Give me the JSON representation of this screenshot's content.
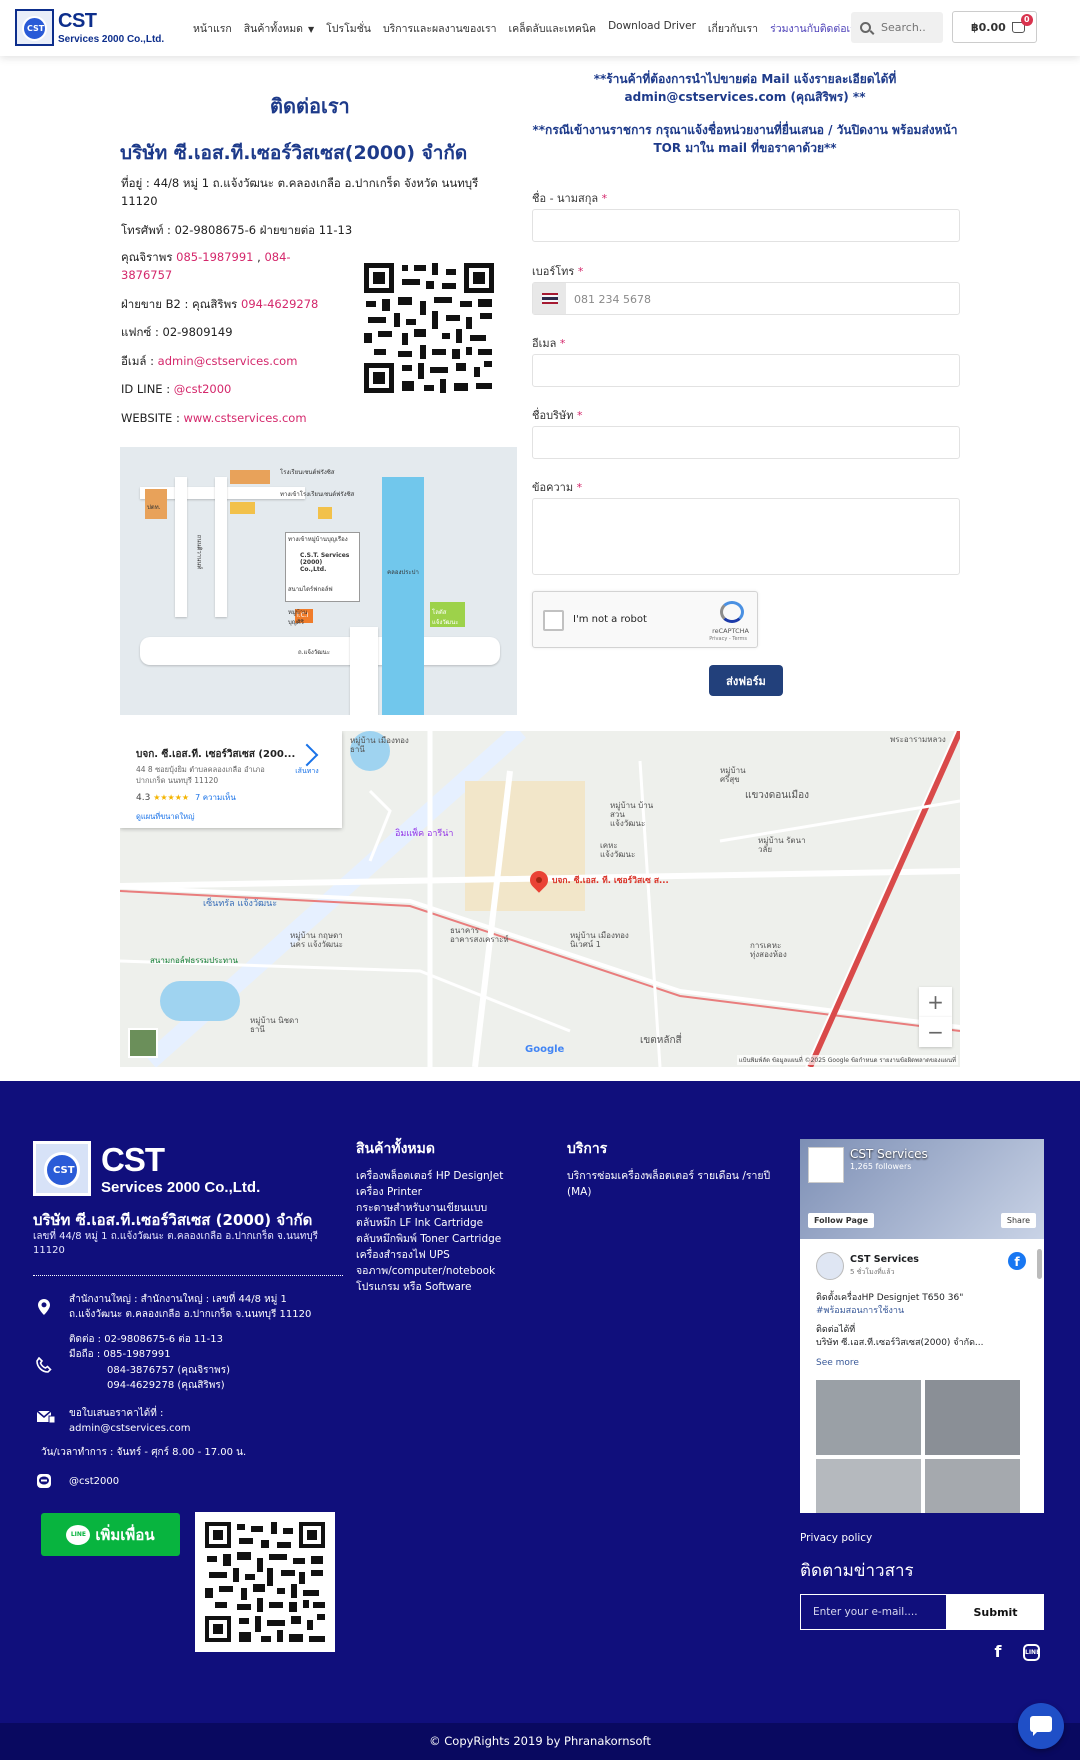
{
  "header": {
    "logo": {
      "big": "CST",
      "small": "Services 2000 Co.,Ltd.",
      "mark": "CST"
    },
    "nav": [
      {
        "label": "หน้าแรก"
      },
      {
        "label": "สินค้าทั้งหมด"
      },
      {
        "label": "โปรโมชั่น"
      },
      {
        "label": "บริการและผลงานของเรา"
      },
      {
        "label": "เคล็ดลับและเทคนิค"
      },
      {
        "label": "Download Driver"
      },
      {
        "label": "เกี่ยวกับเรา"
      },
      {
        "label": "ร่วมงานกับติดต่อเรา"
      }
    ],
    "search_placeholder": "Search..",
    "cart_total": "฿0.00",
    "cart_count": "0"
  },
  "contact": {
    "title": "ติดต่อเรา",
    "company": "บริษัท ซี.เอส.ที.เซอร์วิสเซส(2000) จำกัด",
    "address": "ที่อยู่ : 44/8 หมู่ 1 ถ.แจ้งวัฒนะ ต.คลองเกลือ อ.ปากเกร็ด จังหวัด นนทบุรี 11120",
    "phone": "โทรศัพท์  : 02-9808675-6 ฝ่ายขายต่อ 11-13",
    "mobile_label": "คุณจิราพร ",
    "mobile_1": "085-1987991",
    "mobile_sep": " , ",
    "mobile_2": "084-3876757",
    "sales_label": "ฝ่ายขาย B2 : คุณสิริพร ",
    "sales_phone": "094-4629278",
    "fax": "แฟกซ์ : 02-9809149",
    "email_label": "อีเมล์ : ",
    "email": "admin@cstservices.com",
    "line_label": "ID LINE : ",
    "line_id": "@cst2000",
    "website_label": "WEBSITE : ",
    "website": "www.cstservices.com"
  },
  "route_map": {
    "labels": [
      "โรงเรียนเซนต์ฟรังซิส",
      "ทางเข้าโรงเรียนเซนต์ฟรังซิส",
      "ปตท.",
      "ทางเข้าหมู่บ้านบุญเรือง",
      "C.S.T. Services (2000) Co.,Ltd.",
      "คลองประปา",
      "ถนนติวานนท์",
      "สนามไดร์ฟกอล์ฟ",
      "หมู่บ้านบุญศิริ",
      "I.C.I",
      "โลตัส แจ้งวัฒนะ",
      "ถ.แจ้งวัฒนะ"
    ]
  },
  "form": {
    "notice_1": "**ร้านค้าที่ต้องการนำไปขายต่อ Mail แจ้งรายละเอียดได้ที่ admin@cstservices.com (คุณสิริพร) **",
    "notice_2": "**กรณีเข้างานราชการ กรุณาแจ้งชื่อหน่วยงานที่ยื่นเสนอ / วันปิดงาน พร้อมส่งหน้า TOR มาใน mail ที่ขอราคาด้วย**",
    "fields": [
      {
        "label": "ชื่อ - นามสกุล",
        "required": "*"
      },
      {
        "label": "เบอร์โทร",
        "required": "*",
        "placeholder": "081 234 5678"
      },
      {
        "label": "อีเมล",
        "required": "*"
      },
      {
        "label": "ชื่อบริษัท",
        "required": "*"
      },
      {
        "label": "ข้อความ",
        "required": "*"
      }
    ],
    "captcha_label": "I'm not a robot",
    "captcha_brand": "reCAPTCHA",
    "captcha_terms": "Privacy - Terms",
    "submit": "ส่งฟอร์ม"
  },
  "gmap": {
    "place_name": "บจก. ซี.เอส.ที. เซอร์วิสเซส (200...",
    "place_address": "44 8 ซอยบุ้งยิม ตำบลคลองเกลือ อำเภอ ปากเกร็ด นนทบุรี 11120",
    "rating": "4.3",
    "stars": "★★★★★",
    "reviews": "7 ความเห็น",
    "larger_map": "ดูแผนที่ขนาดใหญ่",
    "directions": "เส้นทาง",
    "pin_label": "บจก. ซี.เอส. ที. เซอร์วิสเซ ส...",
    "labels": [
      "หมู่บ้าน เมืองทองธานี",
      "หมู่บ้าน ศรีสุข",
      "แขวงดอนเมือง",
      "หมู่บ้าน บ้านสวน แจ้งวัฒนะ",
      "เคหะ แจ้งวัฒนะ",
      "หมู่บ้าน รัตนาวลัย",
      "เซ็นทรัล แจ้งวัฒนะ",
      "หมู่บ้าน เมืองทอง นิเวศน์ 1",
      "การเคหะ ทุ่งสองห้อง",
      "หมู่บ้าน นิชดาธานี",
      "เขตหลักสี่",
      "สนามกอล์ฟธรรมประทาน",
      "หมู่บ้าน กฤษดานคร แจ้งวัฒนะ",
      "ธนาคารอาคารสงเคราะห์",
      "อิมแพ็ค อารีน่า",
      "พระอารามหลวง"
    ],
    "logo": "Google",
    "attribution": "แป้นพิมพ์ลัด  ข้อมูลแผนที่ ©2025 Google  ข้อกำหนด  รายงานข้อผิดพลาดของแผนที่",
    "zoom_in": "+",
    "zoom_out": "−"
  },
  "footer": {
    "logo": {
      "big": "CST",
      "small": "Services 2000 Co.,Ltd.",
      "mark": "CST"
    },
    "company": "บริษัท ซี.เอส.ที.เซอร์วิสเซส (2000) จำกัด",
    "address": "เลขที่ 44/8 หมู่ 1 ถ.แจ้งวัฒนะ ต.คลองเกลือ อ.ปากเกร็ด จ.นนทบุรี 11120",
    "office": "สำนักงานใหญ่ : สำนักงานใหญ่ : เลขที่ 44/8 หมู่ 1 ถ.แจ้งวัฒนะ ต.คลองเกลือ อ.ปากเกร็ด จ.นนทบุรี 11120",
    "contact_1": "ติดต่อ : 02-9808675-6 ต่อ 11-13",
    "contact_2": "มือถือ : 085-1987991",
    "contact_3": "084-3876757 (คุณจิราพร)",
    "contact_4": "094-4629278 (คุณสิริพร)",
    "quote_1": "ขอใบเสนอราคาได้ที่ :",
    "quote_2": "admin@cstservices.com",
    "hours": "วัน/เวลาทำการ : จันทร์ - ศุกร์ 8.00 - 17.00 น.",
    "line_id": "@cst2000",
    "line_button": "เพิ่มเพื่อน",
    "line_icon": "LINE",
    "products_heading": "สินค้าทั้งหมด",
    "products": [
      "เครื่องพล็อตเตอร์ HP DesignJet",
      "เครื่อง Printer",
      "กระดาษสำหรับงานเขียนแบบ",
      "ตลับหมึก LF Ink Cartridge",
      "ตลับหมึกพิมพ์ Toner Cartridge",
      "เครื่องสำรองไฟ UPS",
      "จอภาพ/computer/notebook",
      "โปรแกรม หรือ Software"
    ],
    "services_heading": "บริการ",
    "services": [
      "บริการซ่อมเครื่องพล็อตเตอร์ รายเดือน /รายปี (MA)"
    ],
    "fb": {
      "page_name": "CST Services",
      "followers": "1,265 followers",
      "follow": "Follow Page",
      "share": "Share",
      "post_name": "CST Services",
      "post_time": "5 ชั่วโมงที่แล้ว",
      "post_line1": "ติดตั้งเครื่องHP Designjet T650 36\"",
      "post_tag": "#พร้อมสอนการใช้งาน",
      "post_line2": "ติดต่อได้ที่",
      "post_line3": "บริษัท ซี.เอส.ที.เซอร์วิสเซส(2000) จำกัด...",
      "see_more": "See more"
    },
    "privacy": "Privacy policy",
    "newsletter_heading": "ติดตามข่าวสาร",
    "newsletter_placeholder": "Enter your e-mail....",
    "newsletter_submit": "Submit",
    "social_fb": "f",
    "social_line": "LINE"
  },
  "copyright": "© CopyRights 2019 by Phranakornsoft"
}
